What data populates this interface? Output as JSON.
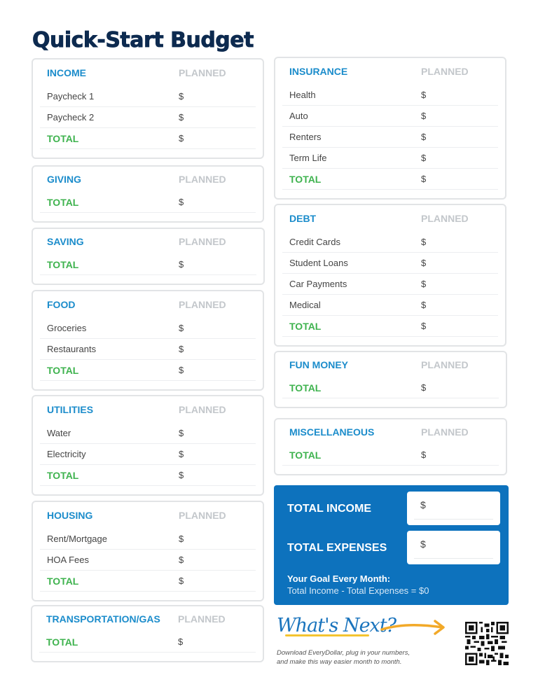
{
  "title": "Quick-Start Budget",
  "planned_label": "PLANNED",
  "currency": "$",
  "categories": {
    "income": {
      "name": "INCOME",
      "rows": [
        "Paycheck 1",
        "Paycheck 2"
      ],
      "total": "TOTAL"
    },
    "giving": {
      "name": "GIVING",
      "rows": [],
      "total": "TOTAL"
    },
    "saving": {
      "name": "SAVING",
      "rows": [],
      "total": "TOTAL"
    },
    "food": {
      "name": "FOOD",
      "rows": [
        "Groceries",
        "Restaurants"
      ],
      "total": "TOTAL"
    },
    "utilities": {
      "name": "UTILITIES",
      "rows": [
        "Water",
        "Electricity"
      ],
      "total": "TOTAL"
    },
    "housing": {
      "name": "HOUSING",
      "rows": [
        "Rent/Mortgage",
        "HOA Fees"
      ],
      "total": "TOTAL"
    },
    "transportation": {
      "name": "TRANSPORTATION/GAS",
      "rows": [],
      "total": "TOTAL"
    },
    "insurance": {
      "name": "INSURANCE",
      "rows": [
        "Health",
        "Auto",
        "Renters",
        "Term Life"
      ],
      "total": "TOTAL"
    },
    "debt": {
      "name": "DEBT",
      "rows": [
        "Credit Cards",
        "Student Loans",
        "Car Payments",
        "Medical"
      ],
      "total": "TOTAL"
    },
    "fun_money": {
      "name": "FUN MONEY",
      "rows": [],
      "total": "TOTAL"
    },
    "miscellaneous": {
      "name": "MISCELLANEOUS",
      "rows": [],
      "total": "TOTAL"
    }
  },
  "summary": {
    "total_income_label": "TOTAL INCOME",
    "total_income_value": "$",
    "total_expenses_label": "TOTAL EXPENSES",
    "total_expenses_value": "$",
    "goal_title": "Your Goal Every Month:",
    "goal_text": "Total Income - Total Expenses = $0"
  },
  "whats_next": {
    "heading": "What's Next?",
    "description_line1": "Download EveryDollar, plug in your numbers,",
    "description_line2": "and make this way easier month to month."
  },
  "colors": {
    "title": "#0d2a4f",
    "category": "#1b8ccb",
    "total": "#3fb34f",
    "planned": "#c3c7cb",
    "summary_bg": "#0d72bd",
    "accent_yellow": "#f4c430"
  }
}
